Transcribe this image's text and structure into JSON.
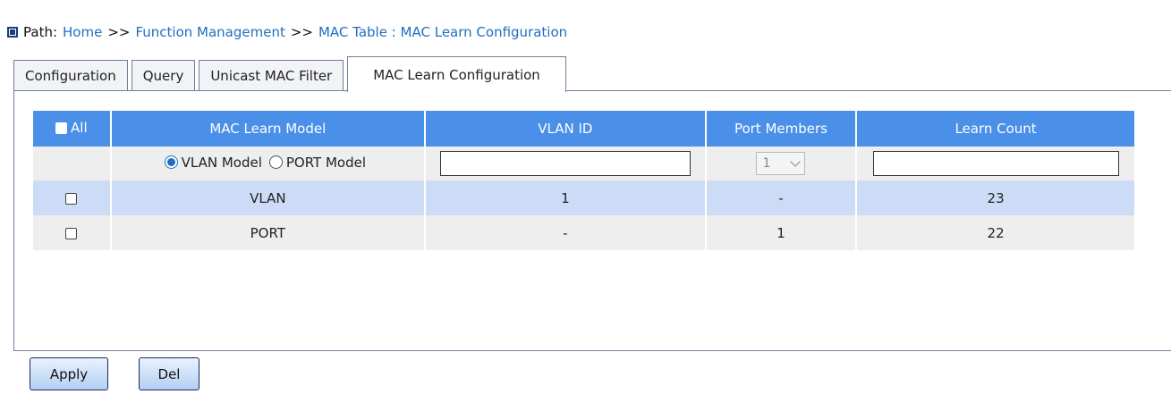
{
  "breadcrumb": {
    "label": "Path:",
    "items": [
      "Home",
      "Function Management",
      "MAC Table : MAC Learn Configuration"
    ],
    "separator": ">>"
  },
  "tabs": [
    {
      "label": "Configuration",
      "active": false
    },
    {
      "label": "Query",
      "active": false
    },
    {
      "label": "Unicast MAC Filter",
      "active": false
    },
    {
      "label": "MAC Learn Configuration",
      "active": true
    }
  ],
  "table": {
    "headers": {
      "all": "All",
      "model": "MAC Learn Model",
      "vlan_id": "VLAN ID",
      "port_members": "Port Members",
      "learn_count": "Learn Count"
    },
    "input_row": {
      "radio_vlan": "VLAN Model",
      "radio_port": "PORT Model",
      "selected_model": "VLAN Model",
      "vlan_id_value": "",
      "port_select_value": "1",
      "learn_count_value": ""
    },
    "rows": [
      {
        "model": "VLAN",
        "vlan_id": "1",
        "port_members": "-",
        "learn_count": "23"
      },
      {
        "model": "PORT",
        "vlan_id": "-",
        "port_members": "1",
        "learn_count": "22"
      }
    ]
  },
  "buttons": {
    "apply": "Apply",
    "del": "Del"
  },
  "colors": {
    "header_bg": "#4a8fe8",
    "row_highlight": "#cddcf6",
    "row_alt": "#eeeeee",
    "link": "#1f6fc2"
  }
}
